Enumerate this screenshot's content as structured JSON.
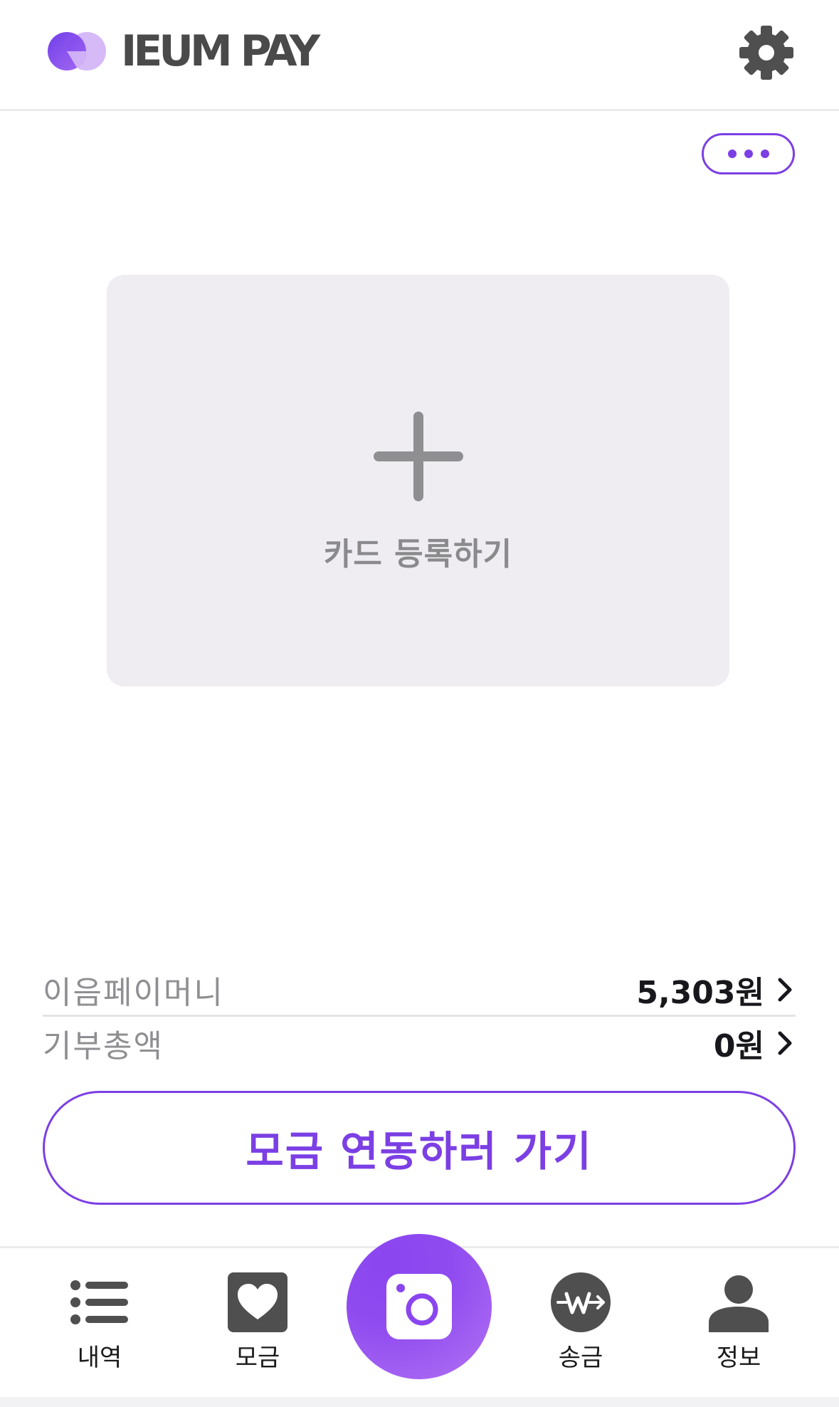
{
  "header": {
    "brand": "IEUM PAY",
    "logo_icon": "ieum-logo-icon",
    "settings_icon": "gear-icon"
  },
  "more_button": {
    "icon": "more-dots-icon"
  },
  "card": {
    "add_label": "카드 등록하기",
    "icon": "plus-icon"
  },
  "balances": [
    {
      "label": "이음페이머니",
      "value": "5,303원"
    },
    {
      "label": "기부총액",
      "value": "0원"
    }
  ],
  "cta": {
    "label": "모금 연동하러 가기"
  },
  "tabs": {
    "history": {
      "label": "내역",
      "icon": "list-icon"
    },
    "collect": {
      "label": "모금",
      "icon": "heart-icon"
    },
    "scan": {
      "icon": "camera-icon"
    },
    "send": {
      "label": "송금",
      "icon": "won-transfer-icon"
    },
    "info": {
      "label": "정보",
      "icon": "person-icon"
    }
  },
  "colors": {
    "accent": "#7b3fe4",
    "card_bg": "#efedf1",
    "label_gray": "#8f8f93",
    "icon_dark": "#505050"
  }
}
